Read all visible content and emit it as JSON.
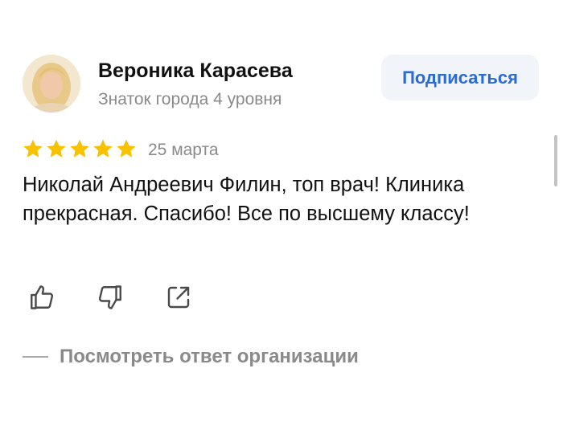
{
  "author": {
    "name": "Вероника Карасева",
    "level": "Знаток города 4 уровня"
  },
  "subscribe_label": "Подписаться",
  "rating": {
    "value": 5,
    "max": 5,
    "star_color": "#f8c200"
  },
  "review": {
    "date": "25 марта",
    "text": "Николай Андреевич Филин, топ врач! Клиника прекрасная. Спасибо! Все по высшему классу!"
  },
  "actions": {
    "like_icon": "thumb-up-icon",
    "dislike_icon": "thumb-down-icon",
    "share_icon": "share-icon"
  },
  "org_response_label": "Посмотреть ответ организации",
  "colors": {
    "accent": "#2a6bd6",
    "muted_text": "#8a8a8a",
    "button_bg": "#f1f4f8"
  }
}
